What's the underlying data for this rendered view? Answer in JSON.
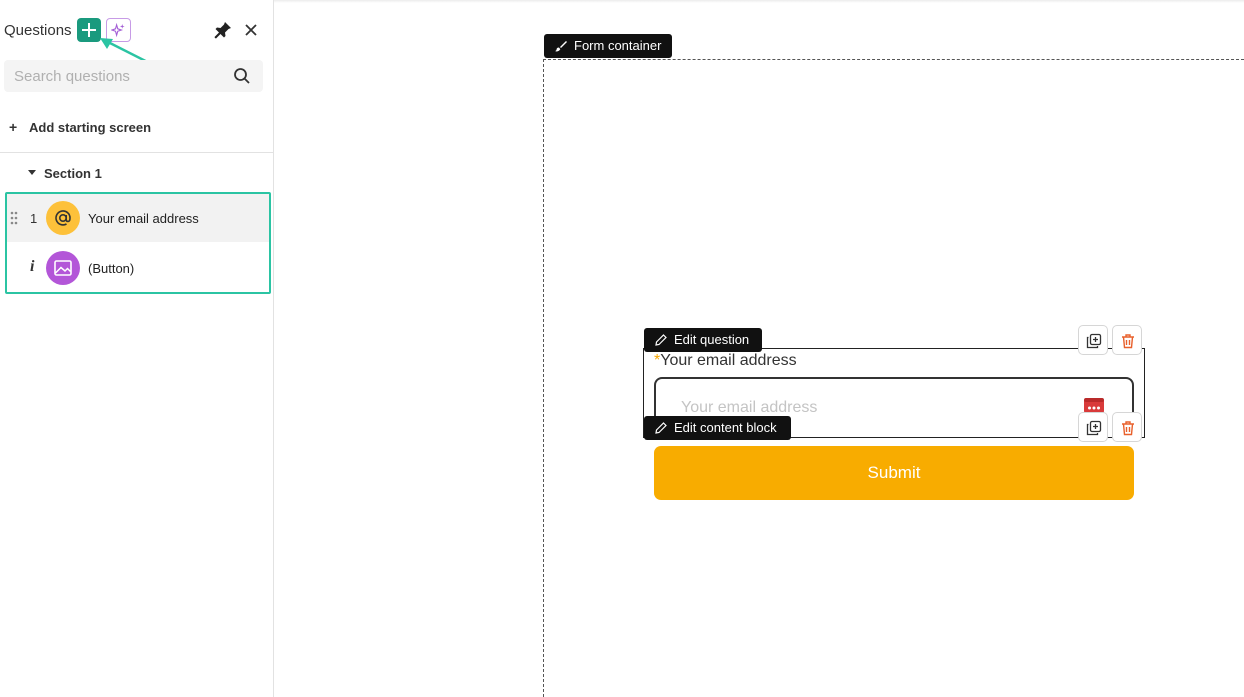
{
  "sidebar": {
    "title": "Questions",
    "search": {
      "placeholder": "Search questions"
    },
    "add_starting_screen_label": "Add starting screen",
    "section": {
      "label": "Section 1"
    },
    "questions": [
      {
        "number": "1",
        "label": "Your email address",
        "icon": "at-sign-icon",
        "color": "#fdc13a"
      },
      {
        "number": "i",
        "label": "(Button)",
        "icon": "image-icon",
        "color": "#b356d8"
      }
    ]
  },
  "canvas": {
    "form_container_tag": "Form container",
    "edit_question_tag": "Edit question",
    "edit_content_block_tag": "Edit content block",
    "question": {
      "required_mark": "*",
      "label": "Your email address",
      "input_placeholder": "Your email address"
    },
    "submit_label": "Submit"
  },
  "colors": {
    "accent": "#1a9a7e",
    "highlight_border": "#2bc4a3",
    "submit": "#f8ac00",
    "required": "#f6a600",
    "delete": "#e8602c"
  }
}
